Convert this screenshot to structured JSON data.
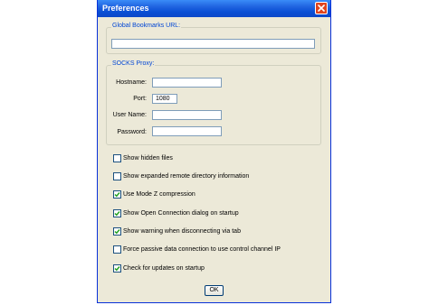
{
  "window": {
    "title": "Preferences"
  },
  "bookmarks": {
    "group_label": "Global Bookmarks URL:",
    "url_value": ""
  },
  "socks": {
    "group_label": "SOCKS Proxy:",
    "hostname_label": "Hostname:",
    "hostname_value": "",
    "port_label": "Port:",
    "port_value": "1080",
    "username_label": "User Name:",
    "username_value": "",
    "password_label": "Password:",
    "password_value": ""
  },
  "options": [
    {
      "label": "Show hidden files",
      "checked": false
    },
    {
      "label": "Show expanded remote directory information",
      "checked": false
    },
    {
      "label": "Use Mode Z compression",
      "checked": true
    },
    {
      "label": "Show Open Connection dialog on startup",
      "checked": true
    },
    {
      "label": "Show warning when disconnecting via tab",
      "checked": true
    },
    {
      "label": "Force passive data connection to use control channel IP",
      "checked": false
    },
    {
      "label": "Check for updates on startup",
      "checked": true
    }
  ],
  "buttons": {
    "ok_label": "OK"
  },
  "icons": {
    "close": "close-icon",
    "check": "checkmark-icon"
  },
  "colors": {
    "title_bar": "#0a4fd4",
    "group_label": "#0046d5",
    "close_button": "#e0441d",
    "checkmark": "#21a121"
  }
}
